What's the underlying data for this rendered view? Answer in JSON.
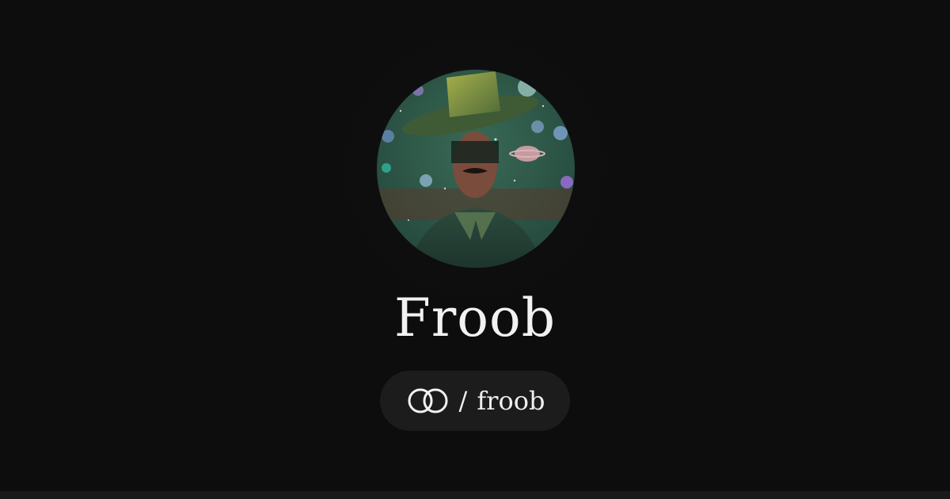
{
  "profile": {
    "name": "Froob",
    "handle_separator": "/",
    "handle": "froob",
    "avatar_icon": "profile-avatar-photo"
  },
  "icons": {
    "brand": "linked-rings-icon"
  },
  "colors": {
    "background": "#0d0d0d",
    "pill_background": "#1c1c1c",
    "text": "#f2f2f2",
    "avatar_tint": "#2f5a48"
  }
}
